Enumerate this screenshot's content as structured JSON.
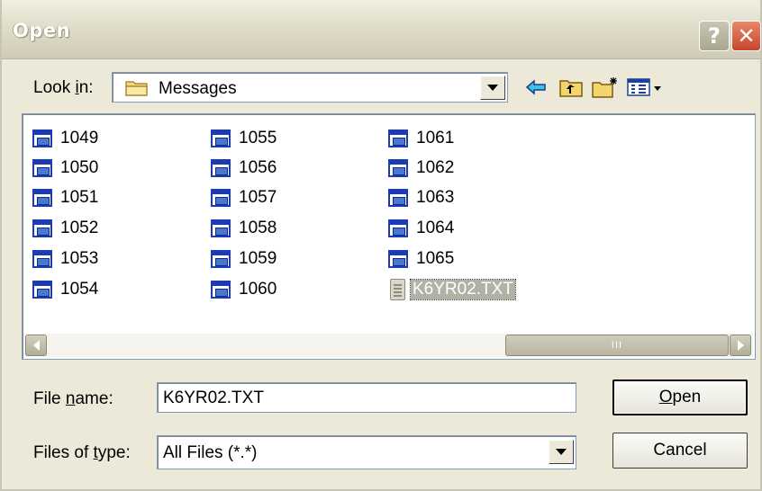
{
  "window": {
    "title": "Open",
    "help_glyph": "?",
    "close_glyph": "✕"
  },
  "toolbar": {
    "lookin_label_pre": "Look ",
    "lookin_label_key": "i",
    "lookin_label_post": "n:",
    "lookin_value": "Messages",
    "icons": [
      "back-arrow-icon",
      "up-one-level-icon",
      "create-new-folder-icon",
      "view-menu-icon"
    ]
  },
  "files": {
    "columns": [
      [
        "1049",
        "1050",
        "1051",
        "1052",
        "1053",
        "1054"
      ],
      [
        "1055",
        "1056",
        "1057",
        "1058",
        "1059",
        "1060"
      ],
      [
        "1061",
        "1062",
        "1063",
        "1064",
        "1065"
      ]
    ],
    "selected": "K6YR02.TXT",
    "scroll_grip": "III"
  },
  "filename": {
    "label_pre": "File ",
    "label_key": "n",
    "label_post": "ame:",
    "value": "K6YR02.TXT"
  },
  "filetype": {
    "label_pre": "Files of ",
    "label_key": "t",
    "label_post": "ype:",
    "value": "All Files (*.*)"
  },
  "buttons": {
    "open_key": "O",
    "open_rest": "pen",
    "cancel": "Cancel"
  }
}
